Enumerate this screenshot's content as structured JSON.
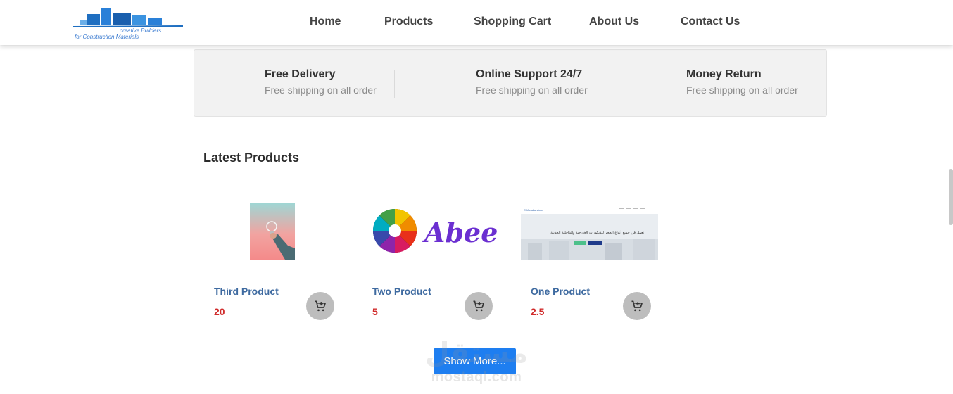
{
  "header": {
    "logo": {
      "line1": "creative Builders",
      "line2": "for Construction Materials",
      "colors": {
        "building": "#1f6fc1",
        "text": "#3b7bd0"
      }
    },
    "nav": [
      "Home",
      "Products",
      "Shopping Cart",
      "About Us",
      "Contact Us"
    ]
  },
  "features": [
    {
      "title": "Free Delivery",
      "subtitle": "Free shipping on all order"
    },
    {
      "title": "Online Support 24/7",
      "subtitle": "Free shipping on all order"
    },
    {
      "title": "Money Return",
      "subtitle": "Free shipping on all order"
    }
  ],
  "latest": {
    "title": "Latest Products",
    "products": [
      {
        "name": "Third Product",
        "price": "20",
        "image": "lightbulb-photo"
      },
      {
        "name": "Two Product",
        "price": "5",
        "image": "abeer-logo",
        "logo_text": "Abeer"
      },
      {
        "name": "One Product",
        "price": "2.5",
        "image": "website-screenshot",
        "screenshot_text": {
          "brand": "ElMosalla store",
          "headline": "نعمل في جميع أنواع الحجر للديكورات الخارجية والداخلية الحديثة"
        }
      }
    ],
    "cart_icon": "add-to-cart-icon",
    "show_more": "Show More..."
  },
  "watermark": {
    "arabic": "مستقل",
    "latin": "mostaql.com"
  },
  "colors": {
    "accent": "#1e7ef0",
    "product_name": "#3e6aa0",
    "price": "#d02b2b",
    "cart_button": "#bdbdbd"
  }
}
